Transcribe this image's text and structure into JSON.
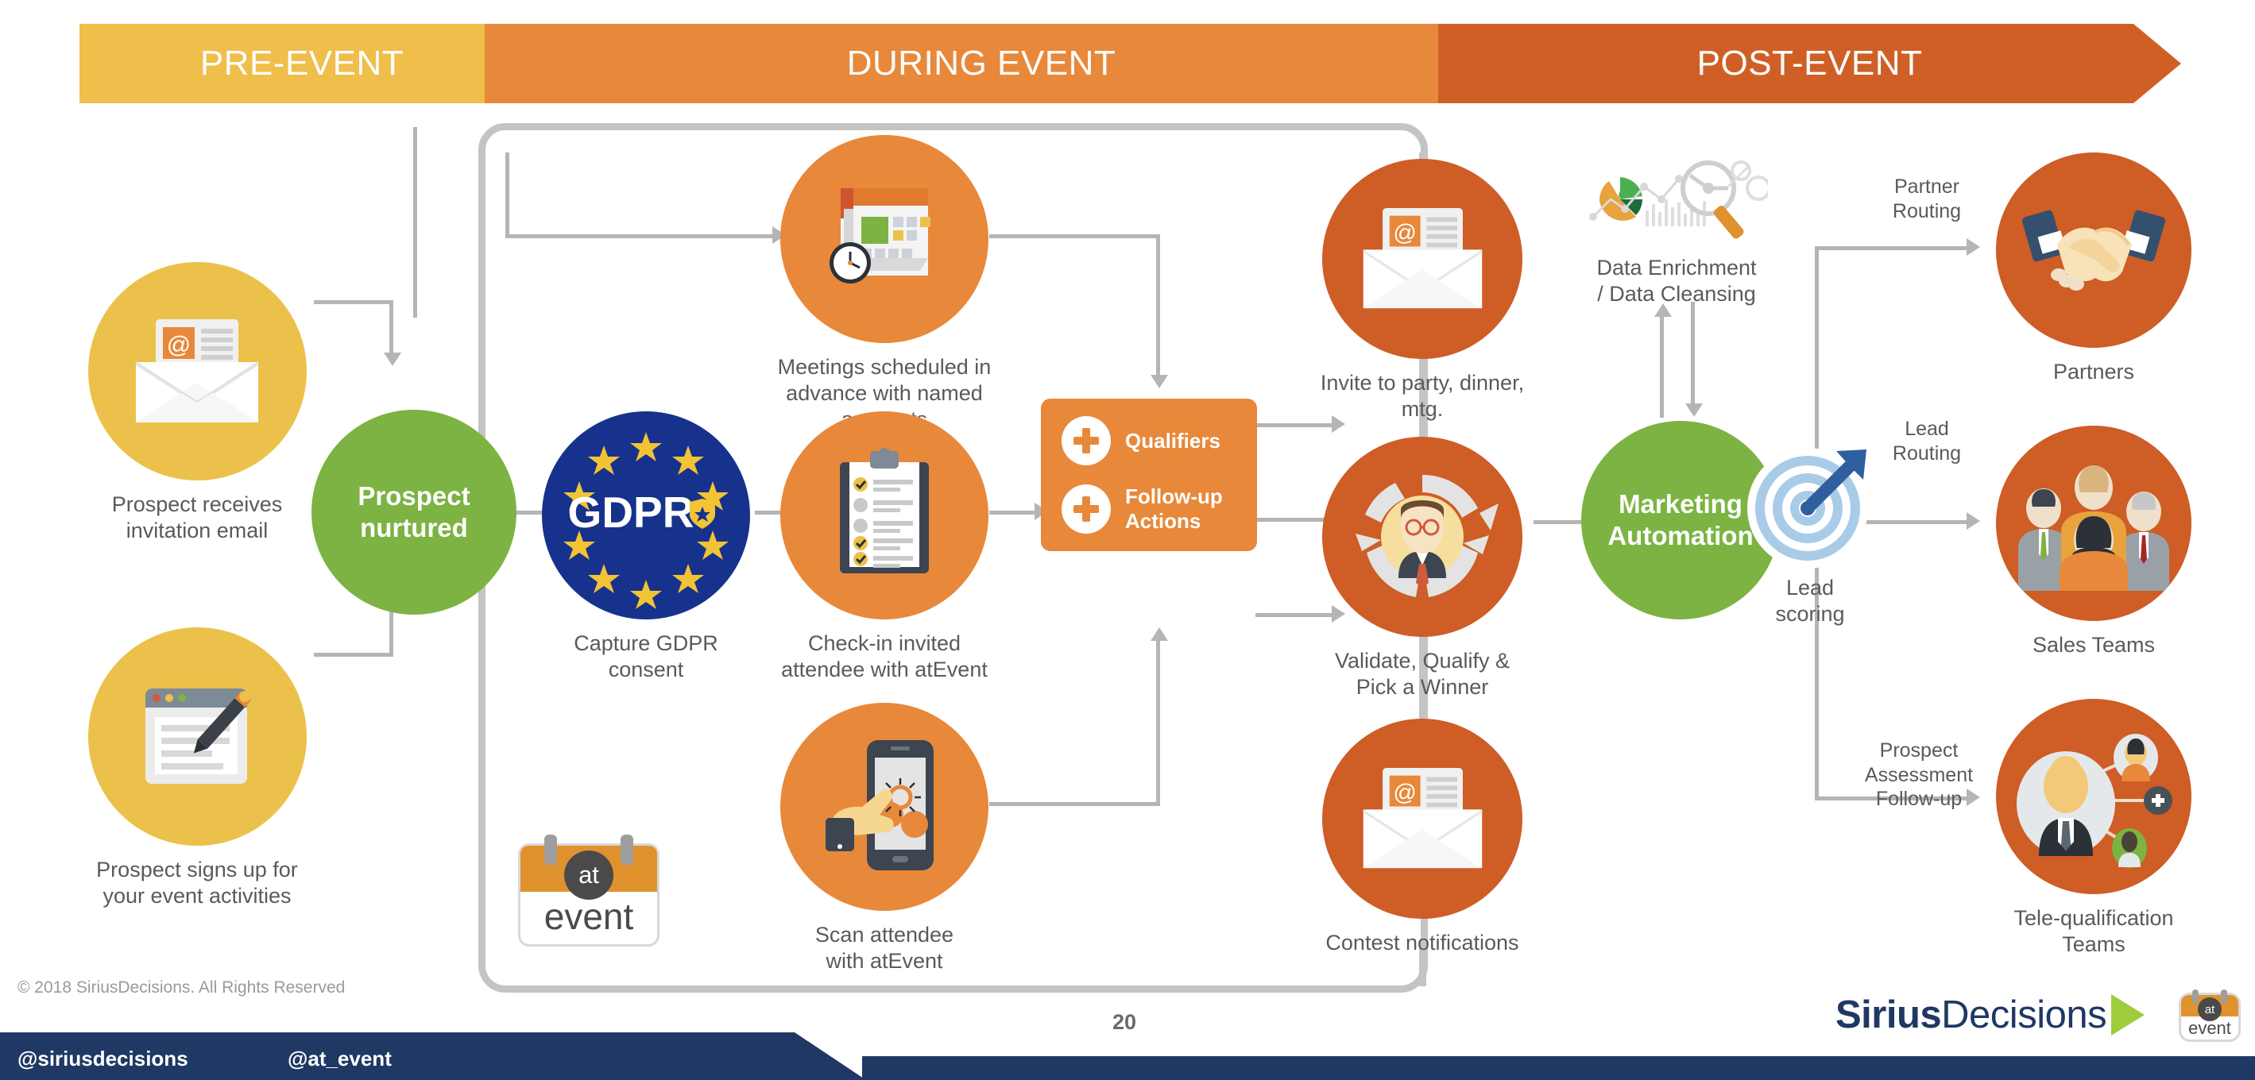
{
  "header": {
    "phases": [
      {
        "label": "PRE-EVENT",
        "color": "#efbe4b"
      },
      {
        "label": "DURING EVENT",
        "color": "#e8883a"
      },
      {
        "label": "POST-EVENT",
        "color": "#d05f26"
      }
    ]
  },
  "nodes": {
    "invitation_email": {
      "label": "Prospect receives\ninvitation email",
      "color": "#ecc14b",
      "icon": "open-envelope-email-icon"
    },
    "signup": {
      "label": "Prospect signs up for\nyour event activities",
      "color": "#ecc14b",
      "icon": "webpage-pencil-icon"
    },
    "prospect_nurtured": {
      "label": "Prospect\nnurtured",
      "color": "#7cb342",
      "icon": "none"
    },
    "gdpr": {
      "label": "Capture GDPR\nconsent",
      "inner_label": "GDPR",
      "color": "#17328c",
      "icon": "eu-stars-shield-icon"
    },
    "meetings": {
      "label": "Meetings scheduled in\nadvance with named accounts",
      "color": "#e8883a",
      "icon": "calendar-clock-icon"
    },
    "checkin": {
      "label": "Check-in invited\nattendee with atEvent",
      "color": "#e8883a",
      "icon": "clipboard-checklist-icon"
    },
    "scan": {
      "label": "Scan attendee\nwith atEvent",
      "color": "#e8883a",
      "icon": "hand-smartphone-tap-icon"
    },
    "invite": {
      "label": "Invite to party, dinner, mtg.",
      "color": "#ce5d26",
      "icon": "open-envelope-email-icon"
    },
    "validate": {
      "label": "Validate, Qualify & Pick a Winner",
      "color": "#ce5d26",
      "icon": "person-refresh-cycle-icon"
    },
    "contest": {
      "label": "Contest notifications",
      "color": "#ce5d26",
      "icon": "open-envelope-email-icon"
    },
    "data_enrichment": {
      "label": "Data Enrichment\n/ Data Cleansing",
      "icon": "analytics-magnifier-icon"
    },
    "marketing_automation": {
      "label": "Marketing\nAutomation",
      "color": "#7cb342",
      "icon": "none"
    },
    "lead_scoring": {
      "label": "Lead\nscoring",
      "icon": "target-dart-icon"
    },
    "partners": {
      "label": "Partners",
      "color": "#ce5d26",
      "icon": "handshake-icon"
    },
    "sales_teams": {
      "label": "Sales Teams",
      "color": "#ce5d26",
      "icon": "people-group-icon"
    },
    "tele_teams": {
      "label": "Tele-qualification Teams",
      "color": "#ce5d26",
      "icon": "person-network-icon"
    }
  },
  "qualifiers_box": {
    "items": [
      {
        "label": "Qualifiers"
      },
      {
        "label": "Follow-up\nActions"
      }
    ],
    "color": "#e8883a"
  },
  "flow_labels": {
    "partner_routing": "Partner\nRouting",
    "lead_routing": "Lead\nRouting",
    "prospect_assessment": "Prospect\nAssessment\nFollow-up"
  },
  "atevent_logo": {
    "top_word": "at",
    "bottom_word": "event"
  },
  "footer": {
    "copyright": "© 2018 SiriusDecisions. All Rights Reserved",
    "page_number": "20",
    "handles": [
      "@siriusdecisions",
      "@at_event"
    ],
    "brand_bold": "Sirius",
    "brand_light": "Decisions"
  }
}
